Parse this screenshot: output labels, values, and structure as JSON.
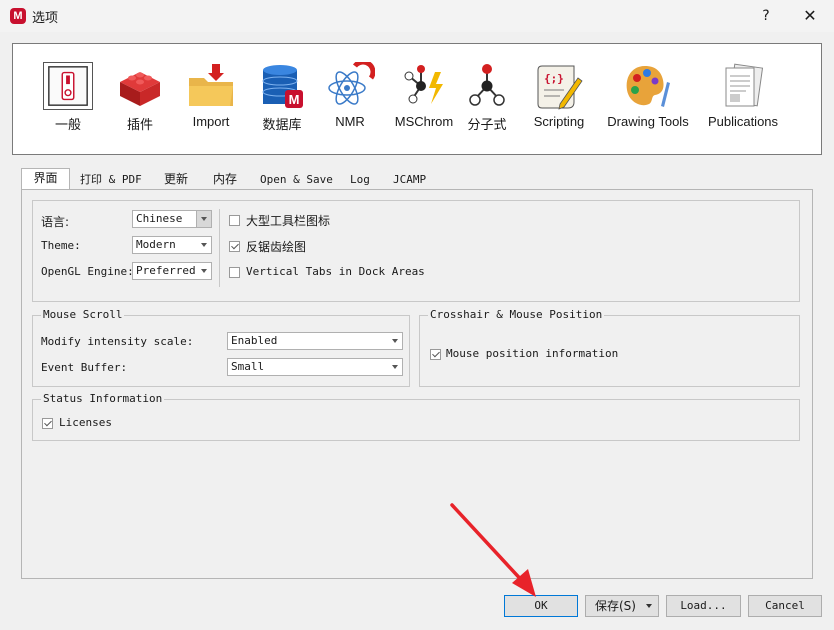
{
  "window": {
    "title": "选项",
    "logo_text": "M",
    "help_glyph": "?",
    "close_glyph": "✕"
  },
  "toolbar": [
    {
      "label": "一般",
      "icon": "switch-icon"
    },
    {
      "label": "插件",
      "icon": "lego-brick-icon"
    },
    {
      "label": "Import",
      "icon": "folder-import-icon"
    },
    {
      "label": "数据库",
      "icon": "database-icon"
    },
    {
      "label": "NMR",
      "icon": "atom-magnet-icon"
    },
    {
      "label": "MSChrom",
      "icon": "molecule-lightning-icon"
    },
    {
      "label": "分子式",
      "icon": "molecule-icon"
    },
    {
      "label": "Scripting",
      "icon": "script-scroll-icon"
    },
    {
      "label": "Drawing Tools",
      "icon": "palette-icon"
    },
    {
      "label": "Publications",
      "icon": "documents-icon"
    }
  ],
  "tabs": [
    "界面",
    "打印 & PDF",
    "更新",
    "内存",
    "Open & Save",
    "Log",
    "JCAMP"
  ],
  "general": {
    "language_label": "语言:",
    "language_value": "Chinese",
    "theme_label": "Theme:",
    "theme_value": "Modern",
    "opengl_label": "OpenGL Engine:",
    "opengl_value": "Preferred",
    "large_toolbar_label": "大型工具栏图标",
    "large_toolbar_checked": false,
    "antialias_label": "反锯齿绘图",
    "antialias_checked": true,
    "vertical_tabs_label": "Vertical Tabs in Dock Areas",
    "vertical_tabs_checked": false
  },
  "mouse_scroll": {
    "title": "Mouse Scroll",
    "intensity_label": "Modify intensity scale:",
    "intensity_value": "Enabled",
    "buffer_label": "Event Buffer:",
    "buffer_value": "Small"
  },
  "crosshair": {
    "title": "Crosshair & Mouse Position",
    "mouse_pos_label": "Mouse position information",
    "mouse_pos_checked": true
  },
  "status": {
    "title": "Status Information",
    "licenses_label": "Licenses",
    "licenses_checked": true
  },
  "buttons": {
    "ok": "OK",
    "save": "保存(S)",
    "load": "Load...",
    "cancel": "Cancel"
  },
  "colors": {
    "accent": "#0078d7",
    "brand": "#c8102e",
    "arrow": "#e8232a"
  }
}
